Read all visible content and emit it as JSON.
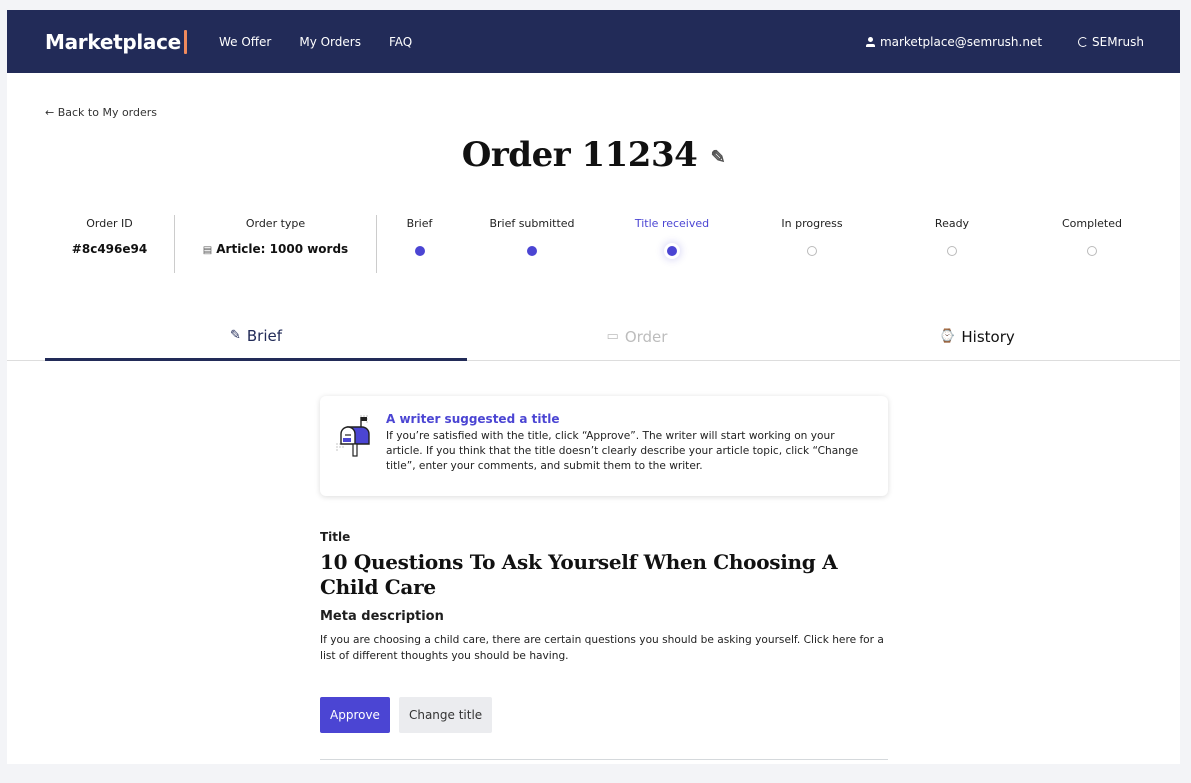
{
  "header": {
    "logo": "Marketplace",
    "nav": [
      "We Offer",
      "My Orders",
      "FAQ"
    ],
    "user_email": "marketplace@semrush.net",
    "brand_link": "SEMrush",
    "colors": {
      "bar": "#222b58",
      "logo_accent": "#f08a5d"
    }
  },
  "back_link": "← Back to My orders",
  "order": {
    "title": "Order 11234",
    "id_label": "Order ID",
    "id_value": "#8c496e94",
    "type_label": "Order type",
    "type_value": "Article: 1000 words"
  },
  "steps": [
    {
      "label": "Brief",
      "state": "done"
    },
    {
      "label": "Brief submitted",
      "state": "done"
    },
    {
      "label": "Title received",
      "state": "current"
    },
    {
      "label": "In progress",
      "state": "todo"
    },
    {
      "label": "Ready",
      "state": "todo"
    },
    {
      "label": "Completed",
      "state": "todo"
    }
  ],
  "tabs": [
    {
      "label": "Brief",
      "icon": "edit-icon",
      "state": "active"
    },
    {
      "label": "Order",
      "icon": "inbox-icon",
      "state": "disabled"
    },
    {
      "label": "History",
      "icon": "watch-icon",
      "state": "normal"
    }
  ],
  "notice": {
    "title": "A writer suggested a title",
    "body": "If you’re satisfied with the title, click “Approve”. The writer will start working on your article. If you think that the title doesn’t clearly describe your article topic, click “Change title”, enter your comments, and submit them to the writer."
  },
  "brief": {
    "title_label": "Title",
    "title_value": "10 Questions To Ask Yourself When Choosing A Child Care",
    "meta_label": "Meta description",
    "meta_value": "If you are choosing a child care, there are certain questions you should be asking yourself. Click here for a list of different thoughts you should be having."
  },
  "actions": {
    "approve": "Approve",
    "change_title": "Change title"
  },
  "accent_color": "#4b45d3"
}
